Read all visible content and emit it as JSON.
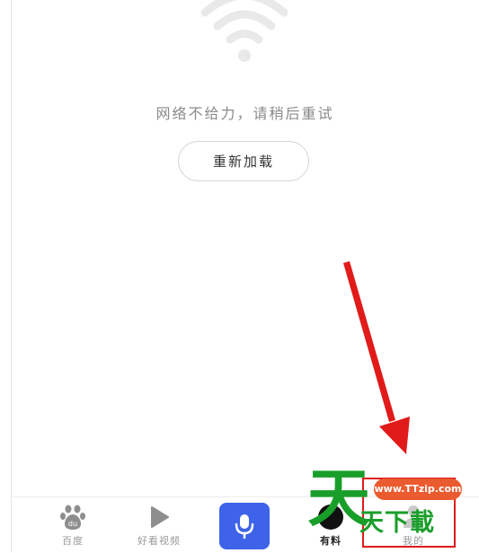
{
  "error": {
    "message": "网络不给力，请稍后重试",
    "icon": "wifi-icon"
  },
  "reload_button": {
    "label": "重新加载"
  },
  "tabbar": {
    "tabs": [
      {
        "label": "百度",
        "icon": "baidu-paw-icon"
      },
      {
        "label": "好看视频",
        "icon": "play-icon"
      },
      {
        "label": "",
        "icon": "microphone-icon"
      },
      {
        "label": "有料",
        "icon": "youliao-icon"
      },
      {
        "label": "我的",
        "icon": "person-icon"
      }
    ],
    "voice_color": "#3e63e8"
  },
  "watermark": {
    "url": "www.TTzip.com",
    "big": "天",
    "small": "天下載"
  },
  "annotation": {
    "color": "#e11a1a"
  }
}
